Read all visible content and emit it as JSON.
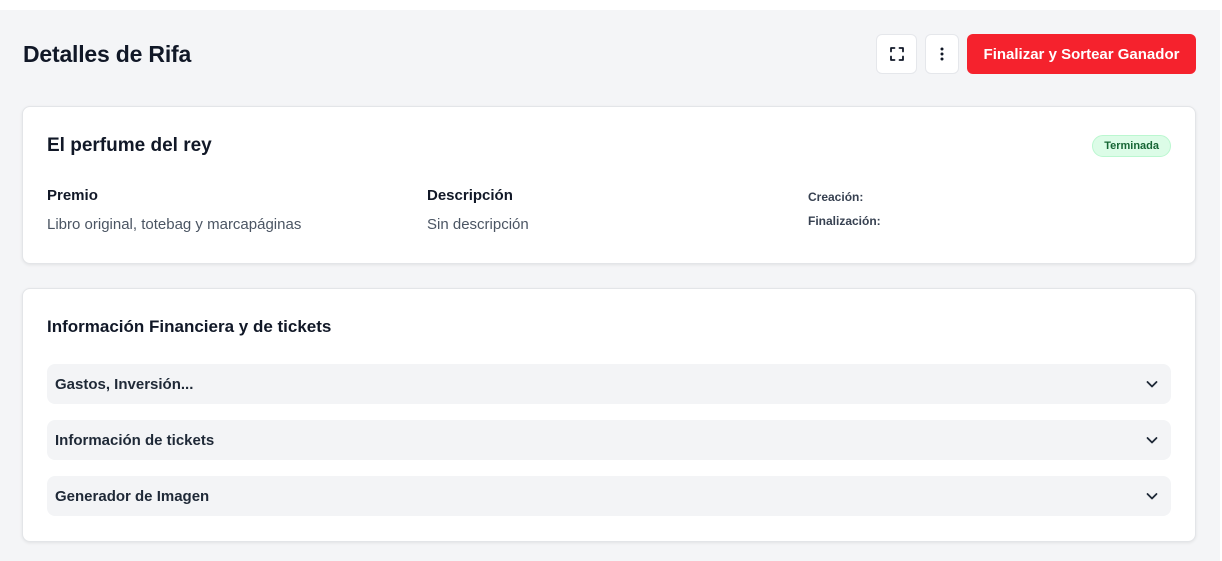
{
  "header": {
    "title": "Detalles de Rifa",
    "expand_icon": "expand-icon",
    "more_icon": "more-vertical-icon",
    "finish_button_label": "Finalizar y Sortear Ganador"
  },
  "raffle": {
    "name": "El perfume del rey",
    "status": "Terminada",
    "prize_label": "Premio",
    "prize_value": "Libro original, totebag y marcapáginas",
    "description_label": "Descripción",
    "description_value": "Sin descripción",
    "creation_label": "Creación:",
    "end_label": "Finalización:"
  },
  "finance": {
    "title": "Información Financiera y de tickets",
    "sections": [
      {
        "label": "Gastos, Inversión..."
      },
      {
        "label": "Información de tickets"
      },
      {
        "label": "Generador de Imagen"
      }
    ]
  },
  "colors": {
    "primary": "#f5222d",
    "badge_bg": "#dcfce7",
    "badge_text": "#166534",
    "page_bg": "#f4f5f7"
  }
}
